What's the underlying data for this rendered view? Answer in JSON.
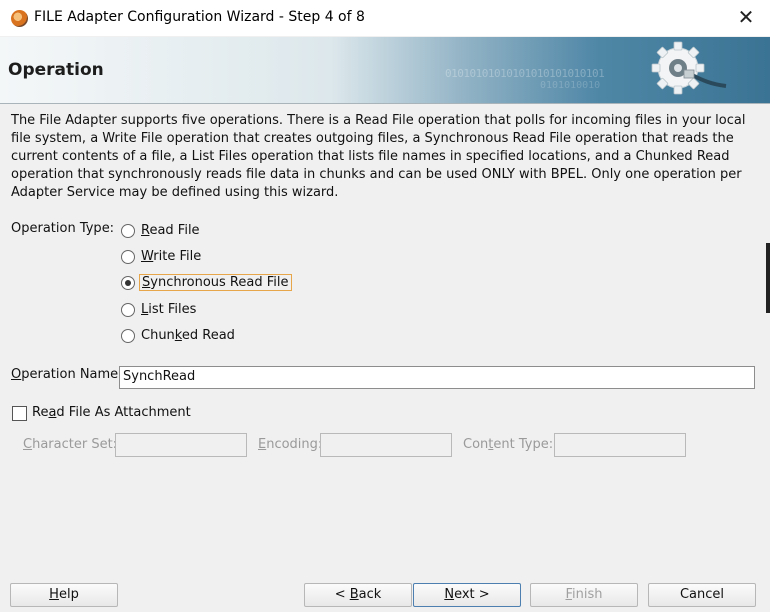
{
  "window": {
    "title": "FILE Adapter Configuration Wizard - Step 4 of 8",
    "close_glyph": "✕",
    "app_icon": "oracle-jdeveloper-icon"
  },
  "header": {
    "title": "Operation",
    "binary_text": "01010101010101010101010101",
    "binary_text2": "0101010010",
    "graphic_icon": "gear-plug-icon"
  },
  "description": "The File Adapter supports five operations.  There is a Read File operation that polls for incoming files in your local file system, a Write File operation that creates outgoing files, a Synchronous Read File operation that reads the current contents of a file, a List Files operation that lists file names in specified locations, and a Chunked Read operation that synchronously reads file data in chunks and can be used ONLY with BPEL. Only one operation per Adapter Service may be defined using this wizard.",
  "operation_type": {
    "label": "Operation Type:",
    "options": [
      {
        "mnemonic": "R",
        "rest": "ead File",
        "selected": false
      },
      {
        "mnemonic": "W",
        "rest": "rite File",
        "selected": false
      },
      {
        "mnemonic": "S",
        "rest": "ynchronous Read File",
        "selected": true
      },
      {
        "mnemonic": "L",
        "rest": "ist Files",
        "selected": false
      },
      {
        "pre": "Chun",
        "mnemonic": "k",
        "rest": "ed Read",
        "selected": false
      }
    ]
  },
  "operation_name": {
    "label_mnemonic": "O",
    "label_rest": "peration Name:",
    "value": "SynchRead"
  },
  "attachment": {
    "label_pre": "Re",
    "label_mnemonic": "a",
    "label_rest": "d File As Attachment",
    "checked": false
  },
  "fields": {
    "charset_mnemonic": "C",
    "charset_rest": "haracter Set:",
    "encoding_mnemonic": "E",
    "encoding_rest": "ncoding:",
    "content_pre": "Con",
    "content_mnemonic": "t",
    "content_rest": "ent Type:"
  },
  "buttons": {
    "help_mnemonic": "H",
    "help_rest": "elp",
    "back_pre": "< ",
    "back_mnemonic": "B",
    "back_rest": "ack",
    "next_mnemonic": "N",
    "next_rest": "ext >",
    "finish_mnemonic": "F",
    "finish_rest": "inish",
    "cancel": "Cancel"
  },
  "colors": {
    "focus_border": "#e8a64a",
    "default_button_border": "#4d7fb0",
    "banner_dark": "#3a7393"
  }
}
